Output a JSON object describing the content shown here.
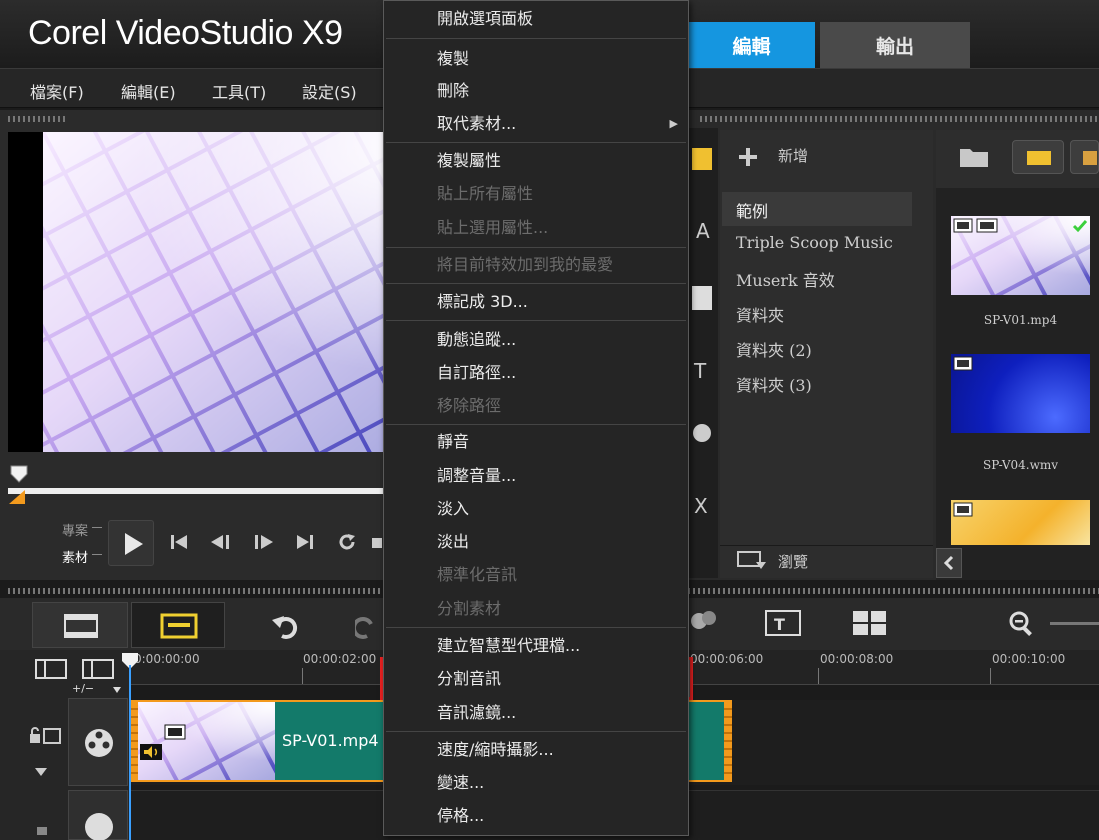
{
  "app": {
    "title": "Corel VideoStudio X9",
    "brand_color": "#1596e0"
  },
  "workspace_tabs": [
    {
      "label": "編輯",
      "active": true
    },
    {
      "label": "輸出",
      "active": false
    }
  ],
  "menubar": [
    "檔案(F)",
    "編輯(E)",
    "工具(T)",
    "設定(S)"
  ],
  "preview": {
    "mode_labels": [
      "專案",
      "素材"
    ],
    "active_mode": "素材",
    "controls": [
      "play-icon",
      "go-to-start-icon",
      "previous-frame-icon",
      "next-frame-icon",
      "go-to-end-icon",
      "repeat-icon"
    ]
  },
  "library": {
    "add_label": "新增",
    "categories": [
      "範例",
      "Triple Scoop Music",
      "Muserk 音效",
      "資料夾",
      "資料夾 (2)",
      "資料夾 (3)"
    ],
    "selected_category": "範例",
    "browse_label": "瀏覽",
    "thumbnails": [
      "SP-V01.mp4",
      "SP-V04.wmv"
    ]
  },
  "timeline": {
    "ruler": [
      "0:00:00:00",
      "00:00:02:00",
      "00:00:06:00",
      "00:00:08:00",
      "00:00:10:00"
    ],
    "track_control_label": "+/−",
    "clip_name": "SP-V01.mp4"
  },
  "context_menu": {
    "groups": [
      [
        {
          "label": "開啟選項面板",
          "enabled": true
        }
      ],
      [
        {
          "label": "複製",
          "enabled": true
        },
        {
          "label": "刪除",
          "enabled": true
        },
        {
          "label": "取代素材...",
          "enabled": true,
          "submenu": true
        }
      ],
      [
        {
          "label": "複製屬性",
          "enabled": true
        },
        {
          "label": "貼上所有屬性",
          "enabled": false
        },
        {
          "label": "貼上選用屬性...",
          "enabled": false
        }
      ],
      [
        {
          "label": "將目前特效加到我的最愛",
          "enabled": false
        }
      ],
      [
        {
          "label": "標記成 3D...",
          "enabled": true
        }
      ],
      [
        {
          "label": "動態追蹤...",
          "enabled": true
        },
        {
          "label": "自訂路徑...",
          "enabled": true
        },
        {
          "label": "移除路徑",
          "enabled": false
        }
      ],
      [
        {
          "label": "靜音",
          "enabled": true
        },
        {
          "label": "調整音量...",
          "enabled": true
        },
        {
          "label": "淡入",
          "enabled": true
        },
        {
          "label": "淡出",
          "enabled": true
        },
        {
          "label": "標準化音訊",
          "enabled": false
        },
        {
          "label": "分割素材",
          "enabled": false
        }
      ],
      [
        {
          "label": "建立智慧型代理檔...",
          "enabled": true
        },
        {
          "label": "分割音訊",
          "enabled": true,
          "highlighted": true
        },
        {
          "label": "音訊濾鏡...",
          "enabled": true
        }
      ],
      [
        {
          "label": "速度/縮時攝影...",
          "enabled": true
        },
        {
          "label": "變速...",
          "enabled": true
        },
        {
          "label": "停格...",
          "enabled": true
        }
      ]
    ]
  }
}
